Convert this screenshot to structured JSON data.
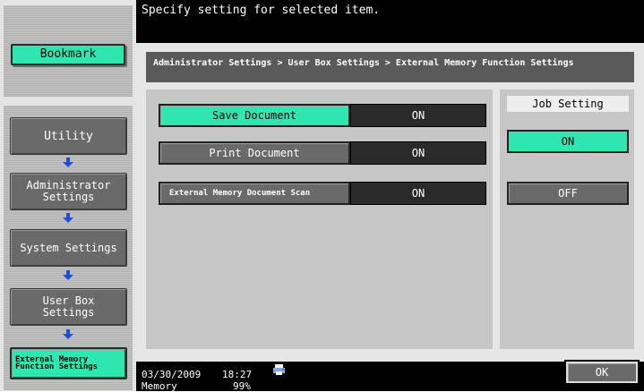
{
  "header": {
    "message": "Specify setting for selected item."
  },
  "sidebar": {
    "bookmark_label": "Bookmark",
    "items": [
      {
        "label": "Utility"
      },
      {
        "label": "Administrator Settings"
      },
      {
        "label": "System Settings"
      },
      {
        "label": "User Box Settings"
      },
      {
        "label": "External Memory Function Settings"
      }
    ]
  },
  "breadcrumb": "Administrator Settings > User Box Settings > External Memory Function Settings",
  "settings": [
    {
      "label": "Save Document",
      "value": "ON",
      "selected": true
    },
    {
      "label": "Print Document",
      "value": "ON",
      "selected": false
    },
    {
      "label": "External Memory Document Scan",
      "value": "ON",
      "selected": false
    }
  ],
  "job_setting": {
    "title": "Job Setting",
    "on_label": "ON",
    "off_label": "OFF",
    "selected": "ON"
  },
  "status": {
    "date": "03/30/2009",
    "time": "18:27",
    "memory_label": "Memory",
    "memory_value": "99%"
  },
  "ok_label": "OK",
  "colors": {
    "accent": "#2fe6b0",
    "dark_button": "#6a6a6a",
    "arrow": "#1a4fd6"
  }
}
